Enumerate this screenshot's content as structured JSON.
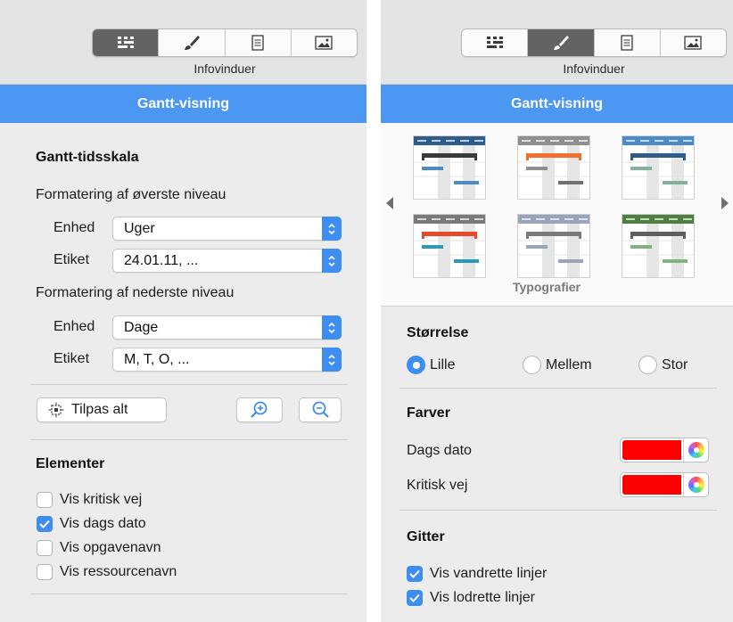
{
  "toolbar": {
    "label": "Infovinduer",
    "buttons": [
      {
        "name": "structure-icon"
      },
      {
        "name": "brush-icon"
      },
      {
        "name": "document-icon"
      },
      {
        "name": "image-icon"
      }
    ]
  },
  "colors": {
    "accent": "#3d8ef0",
    "title_bar": "#4c97f1",
    "today_color": "#ff0000",
    "critical_color": "#ff0000"
  },
  "left": {
    "title": "Gantt-visning",
    "active_tab": "structure",
    "timescale_heading": "Gantt-tidsskala",
    "top_level_heading": "Formatering af øverste niveau",
    "top_unit_label": "Enhed",
    "top_unit_value": "Uger",
    "top_label_label": "Etiket",
    "top_label_value": "24.01.11, ...",
    "bottom_level_heading": "Formatering af nederste niveau",
    "bottom_unit_label": "Enhed",
    "bottom_unit_value": "Dage",
    "bottom_label_label": "Etiket",
    "bottom_label_value": "M, T, O, ...",
    "fit_all_label": "Tilpas alt",
    "elements_heading": "Elementer",
    "checkboxes": [
      {
        "label": "Vis kritisk vej",
        "checked": false
      },
      {
        "label": "Vis dags dato",
        "checked": true
      },
      {
        "label": "Vis opgavenavn",
        "checked": false
      },
      {
        "label": "Vis ressourcenavn",
        "checked": false
      }
    ]
  },
  "right": {
    "title": "Gantt-visning",
    "active_tab": "brush",
    "styles_label": "Typografier",
    "style_themes": [
      {
        "header": "#2e5c8a",
        "bar": "#3a3a3a",
        "sub1": "#4a8ac8",
        "sub2": "#4a8ac8"
      },
      {
        "header": "#8f8f8f",
        "bar": "#f07030",
        "sub1": "#8f8f8f",
        "sub2": "#6f6f6f"
      },
      {
        "header": "#4a8ac8",
        "bar": "#2e5c8a",
        "sub1": "#7fb49a",
        "sub2": "#7fb49a"
      },
      {
        "header": "#7a7a7a",
        "bar": "#e8492a",
        "sub1": "#2a9ab8",
        "sub2": "#2a9ab8"
      },
      {
        "header": "#9aa6b8",
        "bar": "#7a7a7a",
        "sub1": "#9aa6b8",
        "sub2": "#9aa6b8"
      },
      {
        "header": "#4f7f3f",
        "bar": "#5f5f5f",
        "sub1": "#7fb47f",
        "sub2": "#7fb47f"
      }
    ],
    "size_heading": "Størrelse",
    "size_options": [
      {
        "label": "Lille",
        "checked": true
      },
      {
        "label": "Mellem",
        "checked": false
      },
      {
        "label": "Stor",
        "checked": false
      }
    ],
    "colors_heading": "Farver",
    "today_label": "Dags dato",
    "critical_label": "Kritisk vej",
    "grid_heading": "Gitter",
    "grid_checkboxes": [
      {
        "label": "Vis vandrette linjer",
        "checked": true
      },
      {
        "label": "Vis lodrette linjer",
        "checked": true
      }
    ]
  }
}
